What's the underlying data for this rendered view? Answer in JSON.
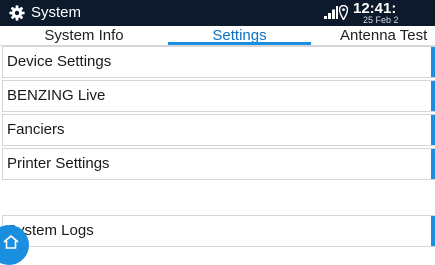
{
  "titlebar": {
    "title": "System",
    "icon": "gear-icon",
    "time": "12:41:",
    "date": "25 Feb 2"
  },
  "tabs": [
    {
      "label": "System Info",
      "active": false
    },
    {
      "label": "Settings",
      "active": true
    },
    {
      "label": "Antenna Test",
      "active": false
    }
  ],
  "list": {
    "items": [
      {
        "label": "Device Settings"
      },
      {
        "label": "BENZING Live"
      },
      {
        "label": "Fanciers"
      },
      {
        "label": "Printer Settings"
      },
      {
        "label": "System Logs"
      }
    ]
  },
  "colors": {
    "titlebar_bg": "#0d1a2c",
    "accent": "#1a8fe0",
    "active_tab_text": "#0e72c4"
  }
}
